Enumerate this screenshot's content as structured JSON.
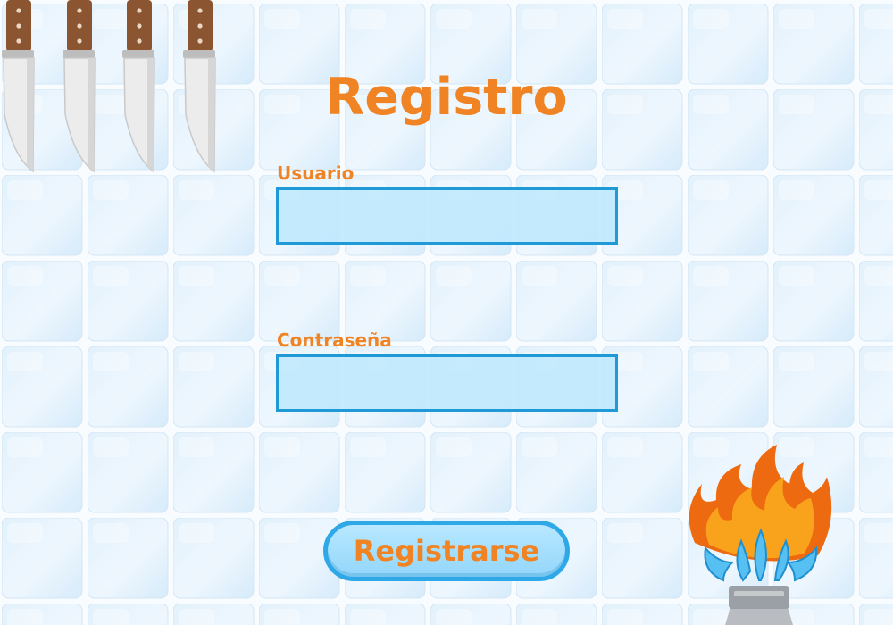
{
  "form": {
    "title": "Registro",
    "username_label": "Usuario",
    "username_value": "",
    "password_label": "Contraseña",
    "password_value": "",
    "submit_label": "Registrarse"
  },
  "decor": {
    "background": "kitchen-tile-wall",
    "top_left": "hanging-knives-icon",
    "bottom_right": "gas-burner-flame-icon"
  },
  "colors": {
    "accent": "#f08424",
    "field_border": "#1f9ad6",
    "field_fill": "#bee8fd",
    "button_border": "#2ea8e6",
    "button_fill": "#a6dffc"
  }
}
